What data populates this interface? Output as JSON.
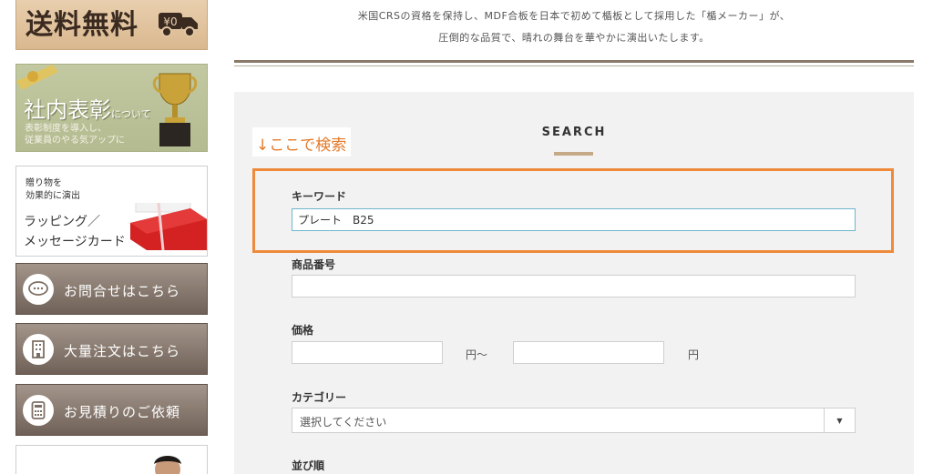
{
  "sidebar": {
    "free_shipping": {
      "text": "送料無料",
      "truck_text": "¥0",
      "icon": "truck-icon"
    },
    "award": {
      "title": "社内表彰",
      "title_small": "について",
      "line1": "表彰制度を導入し、",
      "line2": "従業員のやる気アップに",
      "icon": "trophy-icon"
    },
    "wrapping": {
      "line1": "贈り物を",
      "line2": "効果的に演出",
      "line3": "ラッピング／",
      "line4": "メッセージカード",
      "icon": "gift-box-icon"
    },
    "buttons": [
      {
        "label": "お問合せはこちら",
        "icon": "chat-bubble-icon"
      },
      {
        "label": "大量注文はこちら",
        "icon": "building-icon"
      },
      {
        "label": "お見積りのご依頼",
        "icon": "calculator-icon"
      }
    ]
  },
  "intro": {
    "line1": "米国CRSの資格を保持し、MDF合板を日本で初めて楯板として採用した「楯メーカー」が、",
    "line2": "圧倒的な品質で、晴れの舞台を華やかに演出いたします。"
  },
  "search": {
    "annotation": "↓ここで検索",
    "title": "SEARCH",
    "keyword": {
      "label": "キーワード",
      "value": "プレート　B25"
    },
    "product_number": {
      "label": "商品番号",
      "value": ""
    },
    "price": {
      "label": "価格",
      "from_suffix": "円～",
      "to_suffix": "円",
      "from": "",
      "to": ""
    },
    "category": {
      "label": "カテゴリー",
      "selected": "選択してください"
    },
    "sort": {
      "label": "並び順"
    }
  },
  "colors": {
    "accent_orange": "#ee8a3a",
    "brown_button": "#7d6f65",
    "title_underline": "#c6a987"
  }
}
